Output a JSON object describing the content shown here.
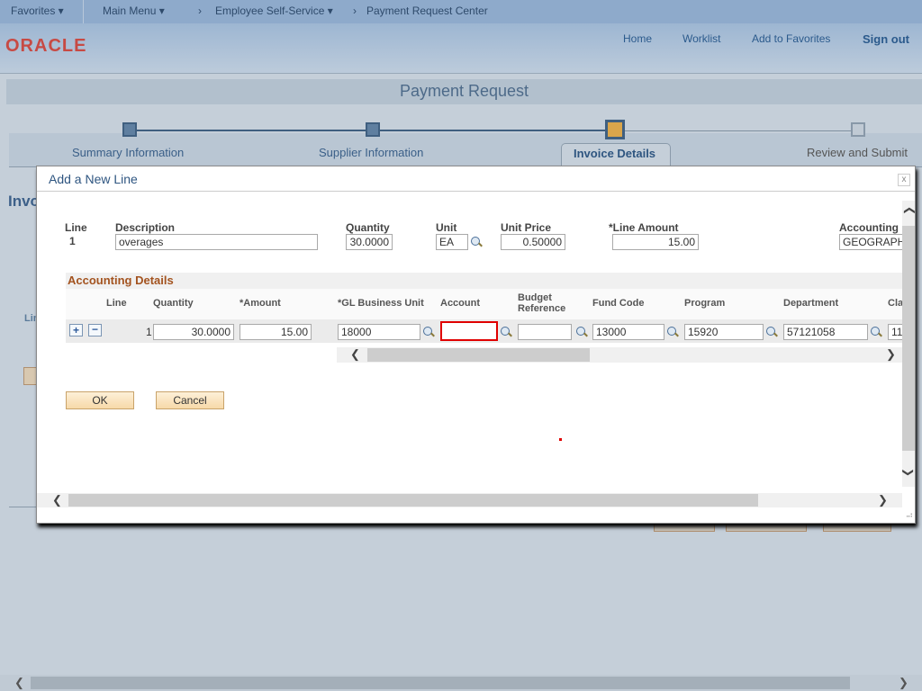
{
  "topnav": {
    "favorites": "Favorites ▾",
    "main_menu": "Main Menu ▾",
    "sep": "›",
    "ess": "Employee Self-Service ▾",
    "center": "Payment Request Center"
  },
  "header": {
    "logo": "ORACLE",
    "links": [
      "Home",
      "Worklist",
      "Add to Favorites"
    ],
    "sign_out": "Sign out"
  },
  "page": {
    "title": "Payment Request",
    "steps": [
      "Summary Information",
      "Supplier Information",
      "Invoice Details",
      "Review and Submit"
    ],
    "active_step": "Invoice Details",
    "bg_heading": "Invo",
    "bg_label": "Lin"
  },
  "modal": {
    "title": "Add a New Line",
    "close": "x",
    "line": {
      "line_label": "Line",
      "line_value": "1",
      "description_label": "Description",
      "description": "overages",
      "quantity_label": "Quantity",
      "quantity": "30.0000",
      "unit_label": "Unit",
      "unit": "EA",
      "unit_price_label": "Unit Price",
      "unit_price": "0.50000",
      "line_amount_label": "*Line Amount",
      "line_amount": "15.00",
      "accounting_label": "Accounting",
      "accounting": "GEOGRAPHIC"
    },
    "accounting": {
      "title": "Accounting Details",
      "columns": [
        "Line",
        "Quantity",
        "*Amount",
        "*GL Business Unit",
        "Account",
        "Budget",
        "Reference",
        "Fund Code",
        "Program",
        "Department",
        "Cla"
      ],
      "row": {
        "line": "1",
        "quantity": "30.0000",
        "amount": "15.00",
        "gl_business_unit": "18000",
        "account": "",
        "budget_reference": "",
        "fund_code": "13000",
        "program": "15920",
        "department": "57121058",
        "class": "11"
      }
    },
    "ok": "OK",
    "cancel": "Cancel"
  },
  "colors": {
    "accent": "#3a5f88",
    "section": "#a3531f",
    "error_border": "#e00000"
  }
}
